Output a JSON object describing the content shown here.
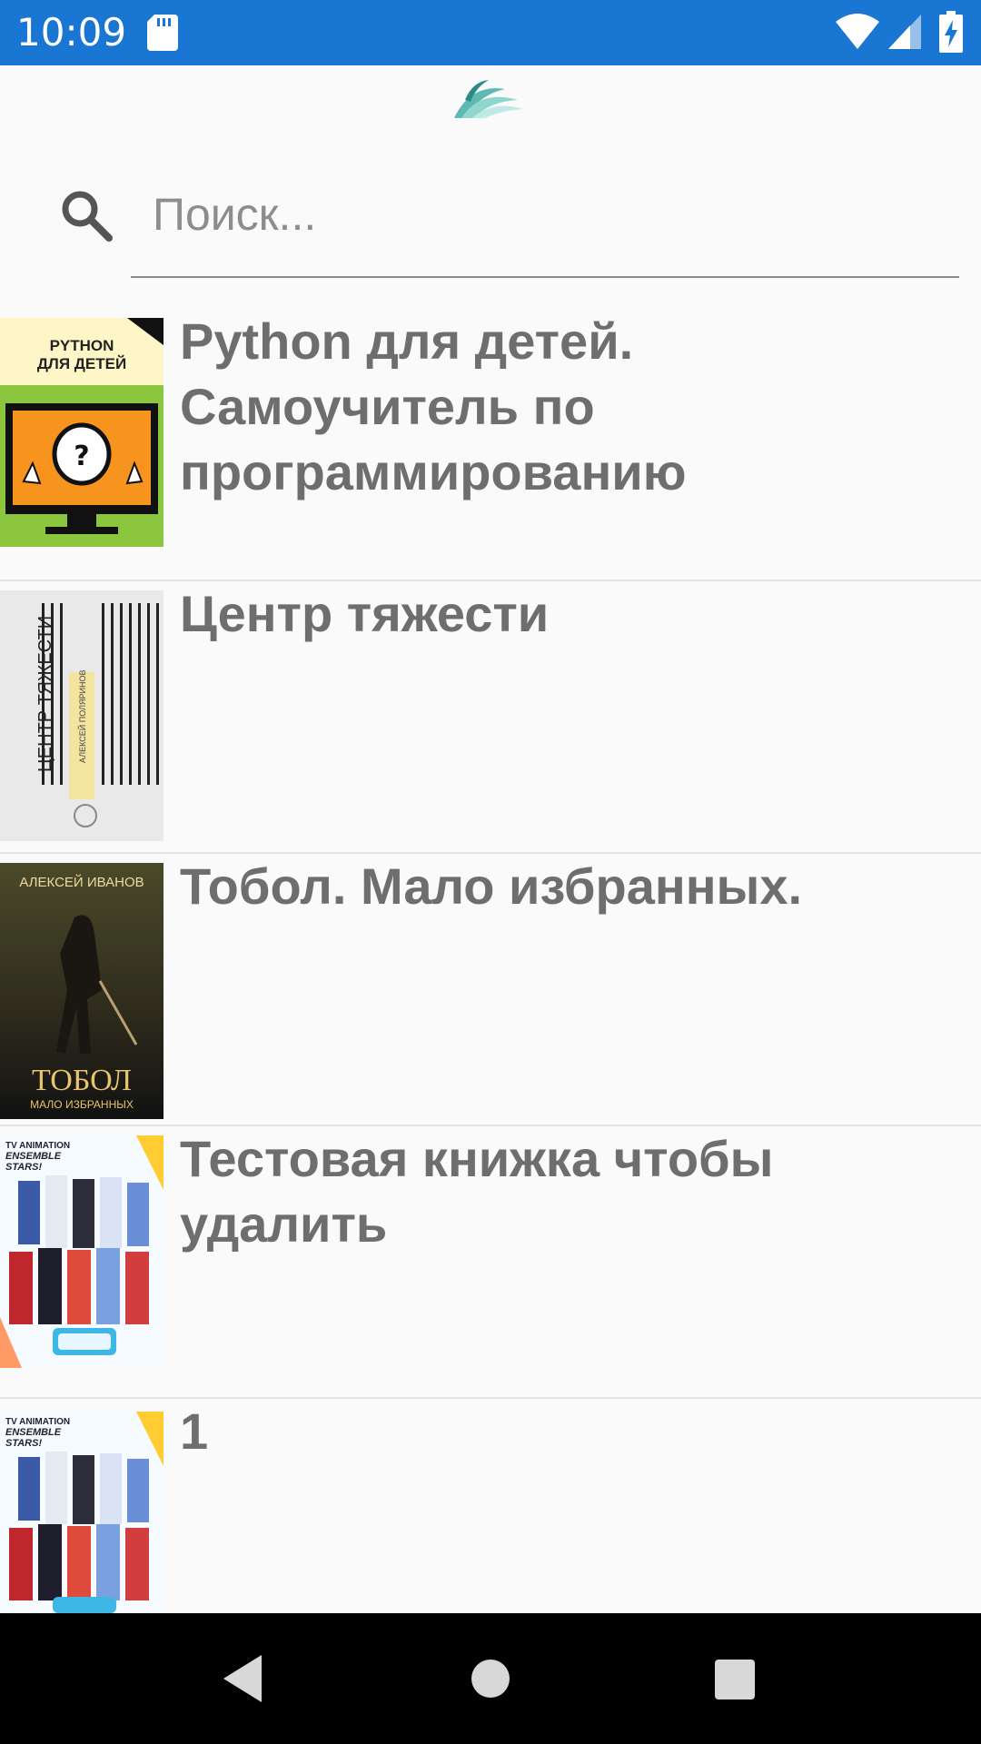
{
  "status_bar": {
    "time": "10:09",
    "icons": [
      "sd-card-icon",
      "wifi-icon",
      "signal-icon",
      "battery-charging-icon"
    ],
    "color": "#1976d2"
  },
  "app": {
    "logo_icon": "book-logo-icon",
    "accent": "#76cbc5"
  },
  "search": {
    "placeholder": "Поиск...",
    "value": "",
    "icon": "search-icon"
  },
  "books": [
    {
      "title": "Python для детей. Самоучитель по программированию",
      "cover_text": [
        "PYTHON",
        "ДЛЯ ДЕТЕЙ"
      ]
    },
    {
      "title": "Центр тяжести",
      "cover_text": [
        "ЦЕНТР ТЯЖЕСТИ",
        "АЛЕКСЕЙ ПОЛЯРИНОВ"
      ]
    },
    {
      "title": "Тобол. Мало избранных.",
      "cover_text": [
        "АЛЕКСЕЙ ИВАНОВ",
        "ТОБОЛ",
        "МАЛО ИЗБРАННЫХ"
      ]
    },
    {
      "title": "Тестовая книжка чтобы удалить",
      "cover_text": [
        "TV ANIMATION",
        "ENSEMBLE",
        "STARS!"
      ]
    },
    {
      "title": "1",
      "cover_text": [
        "TV ANIMATION",
        "ENSEMBLE",
        "STARS!"
      ]
    }
  ],
  "nav_bar": {
    "icons": [
      "back-icon",
      "home-icon",
      "recents-icon"
    ]
  }
}
